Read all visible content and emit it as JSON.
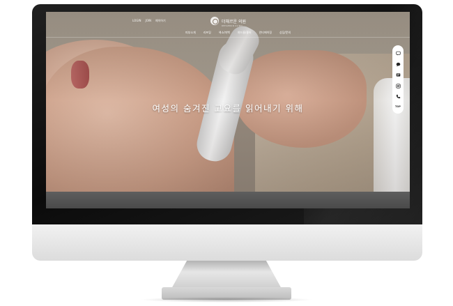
{
  "header": {
    "top_links": [
      "LOGIN",
      "JOIN",
      "예약하기"
    ],
    "logo_text": "더해르운 의원",
    "logo_subtext": "DEHAERUN CLINIC",
    "nav": [
      "피부소개",
      "리프팅",
      "색소/미백",
      "여드름/흉터",
      "안티에이징",
      "상담/문의"
    ]
  },
  "hero": {
    "headline": "여성의 숨겨진 고요를 읽어내기 위해"
  },
  "quick_bar": {
    "icons": [
      "talk-icon",
      "chat-icon",
      "blog-icon",
      "instagram-icon",
      "phone-icon"
    ],
    "top_label": "TOP"
  }
}
